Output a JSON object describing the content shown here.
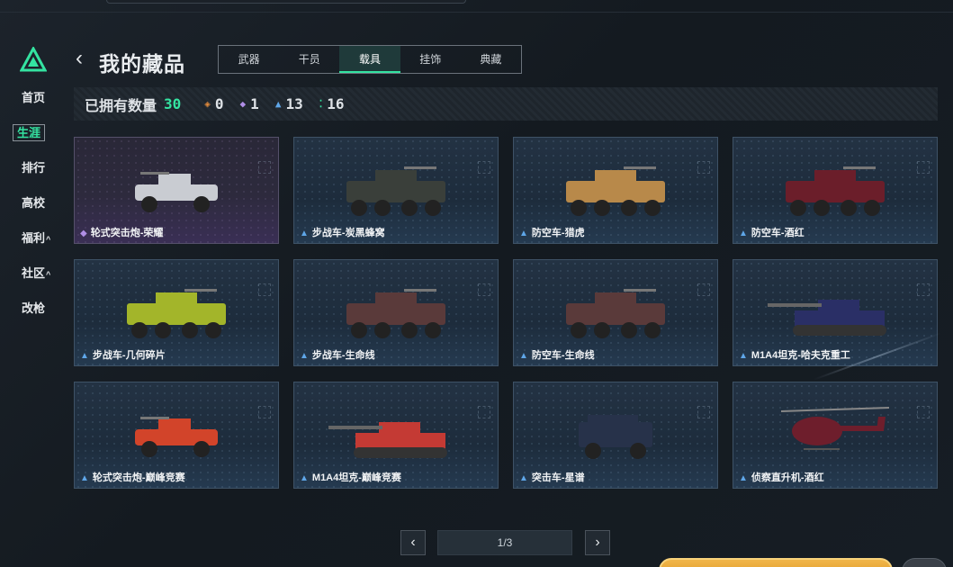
{
  "header": {
    "title": "我的藏品"
  },
  "sidebar": {
    "items": [
      {
        "label": "首页",
        "caret": ""
      },
      {
        "label": "生涯",
        "caret": ""
      },
      {
        "label": "排行",
        "caret": ""
      },
      {
        "label": "高校",
        "caret": ""
      },
      {
        "label": "福利",
        "caret": "^"
      },
      {
        "label": "社区",
        "caret": "^"
      },
      {
        "label": "改枪",
        "caret": ""
      }
    ],
    "active": "生涯"
  },
  "tabs": [
    {
      "label": "武器"
    },
    {
      "label": "干员"
    },
    {
      "label": "载具"
    },
    {
      "label": "挂饰"
    },
    {
      "label": "典藏"
    }
  ],
  "active_tab": "载具",
  "stats": {
    "owned_label": "已拥有数量",
    "owned_count": "30",
    "orange": "0",
    "purple": "1",
    "blue": "13",
    "green": "16"
  },
  "cards": [
    {
      "name": "轮式突击炮-荣耀",
      "rarity": "purple",
      "color": "#c9ccd2"
    },
    {
      "name": "步战车-炭黑蜂窝",
      "rarity": "blue",
      "color": "#3a3f3a"
    },
    {
      "name": "防空车-猎虎",
      "rarity": "blue",
      "color": "#b8894a"
    },
    {
      "name": "防空车-酒红",
      "rarity": "blue",
      "color": "#6b1e2a"
    },
    {
      "name": "步战车-几何碎片",
      "rarity": "blue",
      "color": "#a3b52a"
    },
    {
      "name": "步战车-生命线",
      "rarity": "blue",
      "color": "#5a3a3a"
    },
    {
      "name": "防空车-生命线",
      "rarity": "blue",
      "color": "#5a3a3a"
    },
    {
      "name": "M1A4坦克-哈夫克重工",
      "rarity": "blue",
      "color": "#2a2f66"
    },
    {
      "name": "轮式突击炮-巅峰竞赛",
      "rarity": "blue",
      "color": "#d2442a"
    },
    {
      "name": "M1A4坦克-巅峰竞赛",
      "rarity": "blue",
      "color": "#c43a34"
    },
    {
      "name": "突击车-星谱",
      "rarity": "blue",
      "color": "#27324a"
    },
    {
      "name": "侦察直升机-酒红",
      "rarity": "blue",
      "color": "#6e1e2c"
    }
  ],
  "pagination": {
    "page": "1/3"
  }
}
